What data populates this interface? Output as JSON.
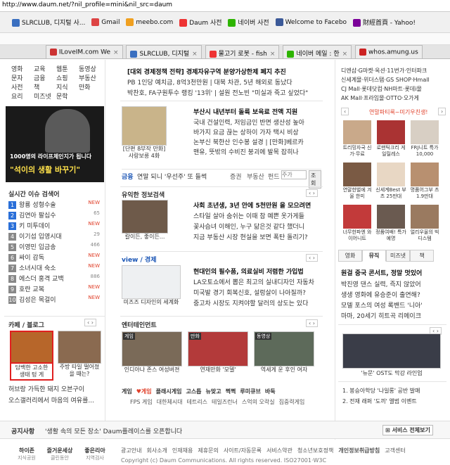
{
  "browser": {
    "url": "http://www.daum.net/?nil_profile=mini&nil_src=daum",
    "bookmarks": [
      {
        "label": "SLRCLUB, 디지털 사...",
        "icon": "slrclub-icon",
        "color": "#3a6fc0"
      },
      {
        "label": "Gmail",
        "icon": "gmail-icon",
        "color": "#d44"
      },
      {
        "label": "meebo.com",
        "icon": "meebo-icon",
        "color": "#f0a020"
      },
      {
        "label": "Daum 사전",
        "icon": "daum-icon",
        "color": "#e33"
      },
      {
        "label": "네이버 사전",
        "icon": "naver-icon",
        "color": "#2db400"
      },
      {
        "label": "Welcome to Facebo",
        "icon": "facebook-icon",
        "color": "#3b5998"
      },
      {
        "label": "財經首頁 - Yahoo!",
        "icon": "yahoo-icon",
        "color": "#7b0099"
      }
    ],
    "tabs": [
      {
        "label": "ILoveIM.com We",
        "icon": "iloveim-icon",
        "color": "#c33"
      },
      {
        "label": "SLRCLUB, 디지털",
        "icon": "slrclub-icon",
        "color": "#3a6fc0"
      },
      {
        "label": "물고기 로봇 - fish",
        "icon": "daum-icon",
        "color": "#e33"
      },
      {
        "label": "네이버 메일 : 한",
        "icon": "naver-icon",
        "color": "#2db400"
      },
      {
        "label": "whos.amung.us",
        "icon": "whos-icon",
        "color": "#c22"
      }
    ]
  },
  "left": {
    "menu": [
      [
        "영화",
        "교육",
        "웹툰",
        "동영상"
      ],
      [
        "문자",
        "금융",
        "쇼핑",
        "부동산"
      ],
      [
        "사전",
        "책",
        "지식",
        "만화"
      ],
      [
        "요리",
        "미즈넷",
        "문학",
        ""
      ]
    ],
    "banner": {
      "line1": "1000명의 라이프체인지가 됩니다",
      "line2": "\"석이의 생활 바꾸기\""
    },
    "issues_title": "실시간 이슈 검색어",
    "issues": [
      {
        "n": "1",
        "text": "왕룡 성형수술",
        "tag": "NEW"
      },
      {
        "n": "2",
        "text": "김연아 팔십수",
        "tag": "65"
      },
      {
        "n": "3",
        "text": "키 미투데이",
        "tag": "NEW"
      },
      {
        "n": "4",
        "text": "이기섭 입영시대",
        "tag": "29"
      },
      {
        "n": "5",
        "text": "이영민 입금송",
        "tag": "466"
      },
      {
        "n": "6",
        "text": "싸이 감독",
        "tag": "NEW"
      },
      {
        "n": "7",
        "text": "소녀시대 숙소",
        "tag": "NEW"
      },
      {
        "n": "8",
        "text": "에스더 홍격 교백",
        "tag": "886"
      },
      {
        "n": "9",
        "text": "호란 교복",
        "tag": "NEW"
      },
      {
        "n": "10",
        "text": "김성은 목걸이",
        "tag": "NEW"
      }
    ],
    "cafe_title": "카페 / 블로그",
    "cafe_items": [
      {
        "caption": "담백한 고소한 생태 텅 게"
      },
      {
        "caption": "주방 타일 떨어졌을 때는?"
      }
    ],
    "cafe_lines": [
      "허브랑 가득한 돼지 오븐구이",
      "오스갤러리에서 마음의 여유를..."
    ]
  },
  "main": {
    "top_heads": [
      "[대외 경제정책 전략] 경제자유구역 분양가상한제 폐지 추진",
      "PB 1인당 예치금, 8억3천만원 | 대북 차관, 5년 해외로 동났다",
      "박찬호, FA구원투수 랭킹 '13위' | 설원 전노빈 \"미실과 죽고 싶었다\""
    ],
    "news1": {
      "head": "부산시 내년부터 돌륙 보육료 전액 지원",
      "lines": [
        "국내 건설인력, 저임금인 반면 생산성 높아",
        "바가지 요금 끊는 상하이 가자 택시 비상",
        "논부신 북한산 인수봉 설경 | [만화]베르카",
        "맨유, 뜻밖의 수비진 붕괴에 발목 잡히나"
      ],
      "img_caption": "[단편 8부작 만화] 사랑보릉 4화"
    },
    "finance": {
      "labels": [
        "금융",
        "연말 되니 '우선주' 또 들썩"
      ],
      "tabs": [
        "증권",
        "부동산",
        "펀드"
      ],
      "placeholder": "주가",
      "btn": "조회"
    },
    "useful": {
      "title": "유익한 정보검색",
      "head": "사회 초년생, 3년 안에 5천만원 을 모으려면",
      "lines": [
        "스타일 살아 숨쉬는 이때 참 예쁜 옷가게들",
        "꽃사슴녀 이해인, 누구 닮은것 같다 했더니",
        "지금 부동산 시장 현실을 보면 폭탄 돌리기?"
      ],
      "img_caption": "칼이든, 좋이든..."
    },
    "view": {
      "title": "view / 경제",
      "head": "현대인의 필수품, 의료실비 저렴한 가입법",
      "lines": [
        "LA오토쇼에서 뽑은 최고의 실내디자인 자동차",
        "미국발 경기 회복신호, 설렁살이 나아질까?",
        "중고차 시장도 지켜야할 달러의 상도는 있다"
      ],
      "img_caption": "미즈즈 디자인의 세계화"
    },
    "entertain": {
      "title": "엔터테인먼트",
      "items": [
        {
          "tag": "게임",
          "caption": "인디아나 존스 여성버젼"
        },
        {
          "tag": "만화",
          "caption": "연재만화 '모델'"
        },
        {
          "tag": "동영상",
          "caption": "역세게 운 후인 여자"
        }
      ],
      "games": [
        "게임",
        "♥게임",
        "플래시게임",
        "고스톱",
        "뉴맞고",
        "쩍쩍",
        "루미큐브",
        "바둑"
      ],
      "games2": [
        "FPS 게임",
        "대한체시대",
        "테트리스",
        "테일즈런너",
        "스억의 오락실",
        "집중력게임"
      ]
    }
  },
  "right": {
    "shop_lines": [
      "디엔샵·G마켓·옥션·11번가·인터파크",
      "신세계몰·위더스탬·GS SHOP·Hmall",
      "CJ Mall·롯데닷컴·NH마트·롯데i몰",
      "AK Mall·프라임몰·OTTO·오가게"
    ],
    "promo": "연말파티룩~미기우친생!",
    "shop_items": [
      [
        "트리밍자국 신가·무료",
        "로맨틱크리 게일릴레스",
        "FRJ니트 특가10,000"
      ],
      [
        "연말한벌에 겨울 한미",
        "신세계Best 부츠 25만대",
        "명품어그부 츠 1.9만대"
      ],
      [
        "너무한파엔 와이어니트",
        "정품여배! 특가예명",
        "얼리우울의 빅 디스템"
      ]
    ],
    "tabs": [
      "영화",
      "뮤직",
      "미즈넷",
      "책"
    ],
    "music_head": "원걸 중국 콘서트, 정말 멋있어",
    "music_lines": [
      "박진영 댄스 실력, 즉지 않았어",
      "생생 영화에 유승준이 출연해?",
      "모델 포스의 여성 록밴드 '니아'",
      "마마, 20세기 히트곡 리메이크"
    ],
    "music_caption": "'뉴문' OST도 막강 라인업",
    "music_list": [
      "1. 봉승아학당 '나일롱' 공반 발매",
      "2. 전재 래퍼 '도끼' 앨범 이벤트"
    ]
  },
  "notice": {
    "label": "공지사항",
    "text": "'생활 속의 모든 장소' Daum플레이스를 오픈합니다",
    "btn": "서비스 전체보기"
  },
  "footer": {
    "brands": [
      [
        "하이존",
        "지식공원"
      ],
      [
        "즐거운세상",
        "클린동안"
      ],
      [
        "좋은리아",
        "지역검사"
      ]
    ],
    "links": [
      "광고안내",
      "회사소개",
      "인재채용",
      "제휴문의",
      "사이트/자동문록",
      "서비스약관",
      "청소년보호정책",
      "개인정보취급방침",
      "고객센터"
    ],
    "copyright": "Copyright (c) Daum Communications. All rights reserved. ISO27001·W3C"
  }
}
